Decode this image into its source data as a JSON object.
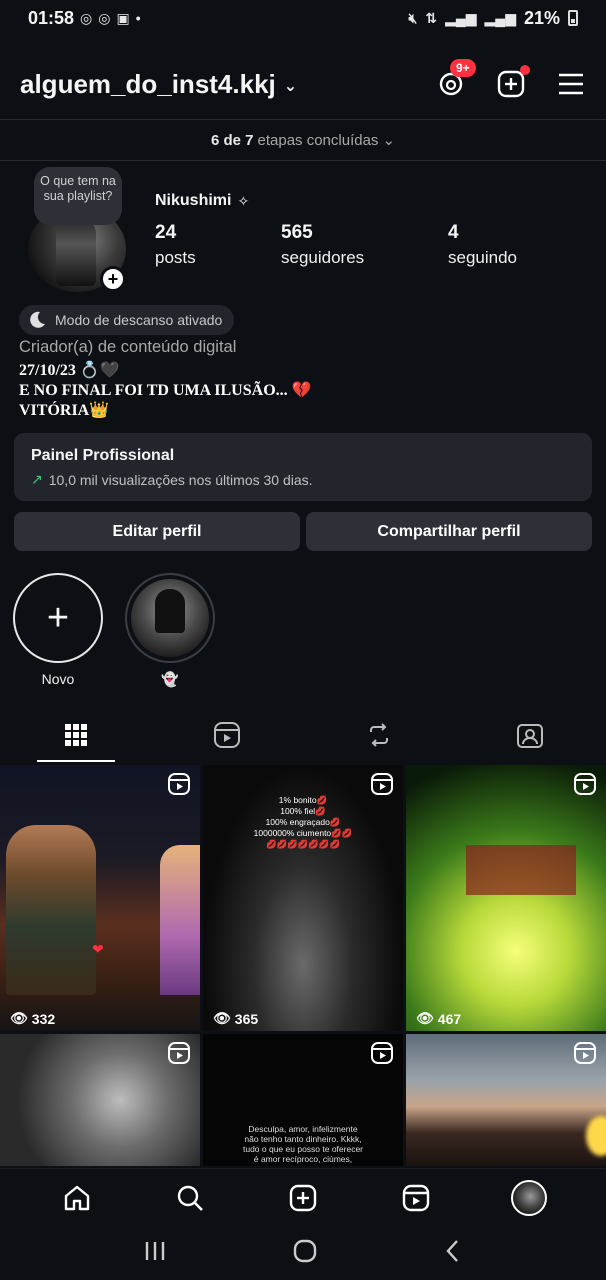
{
  "status_bar": {
    "time": "01:58",
    "battery": "21%"
  },
  "header": {
    "username": "alguem_do_inst4.kkj",
    "threads_badge": "9+"
  },
  "steps": {
    "count": "6 de 7",
    "label": "etapas concluídas"
  },
  "profile": {
    "note": "O que tem na sua playlist?",
    "display_name": "Nikushimi",
    "stats": [
      {
        "num": "24",
        "label": "posts"
      },
      {
        "num": "565",
        "label": "seguidores"
      },
      {
        "num": "4",
        "label": "seguindo"
      }
    ],
    "rest_mode": "Modo de descanso ativado",
    "category": "Criador(a) de conteúdo digital",
    "bio": [
      "27/10/23 💍🖤",
      "E NO FINAL FOI TD UMA ILUSÃO... 💔",
      "VITÓRIA👑"
    ]
  },
  "pro_panel": {
    "title": "Painel Profissional",
    "subtitle": "10,0 mil visualizações nos últimos 30 dias."
  },
  "buttons": {
    "edit": "Editar perfil",
    "share": "Compartilhar perfil"
  },
  "highlights": [
    {
      "label": "Novo"
    },
    {
      "label": "👻"
    }
  ],
  "posts": [
    {
      "views": "332"
    },
    {
      "views": "365",
      "caption": "1% bonito💋\n100% fiel💋\n100% engraçado💋\n1000000% ciumento💋💋\n💋💋💋💋💋💋💋"
    },
    {
      "views": "467"
    },
    {
      "views": ""
    },
    {
      "views": "",
      "caption": "Desculpa, amor, infelizmente\nnão tenho tanto dinheiro. Kkkk,\ntudo o que eu posso te oferecer\né amor recíproco, ciúmes,"
    },
    {
      "views": ""
    }
  ]
}
